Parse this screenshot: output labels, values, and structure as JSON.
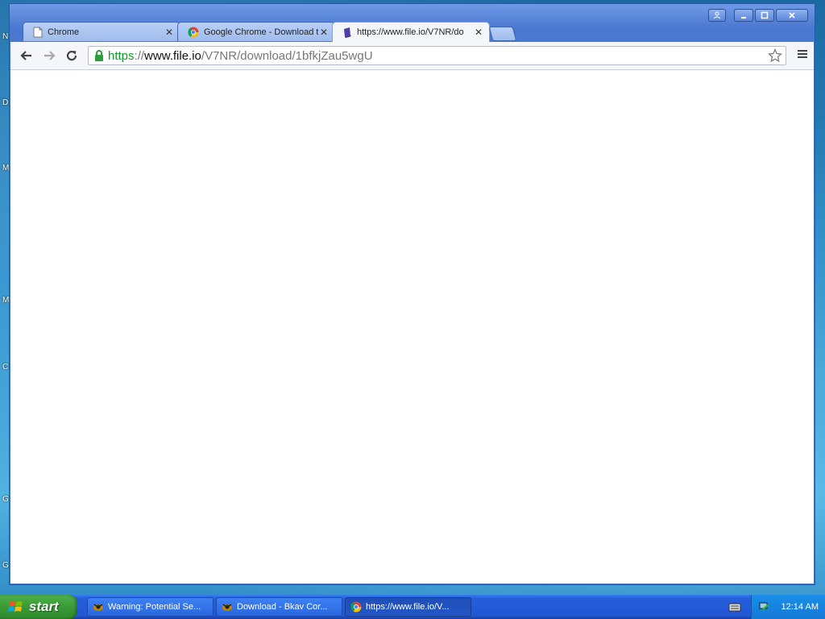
{
  "desktop": {
    "letters": [
      "N",
      "D",
      "M",
      "M",
      "C",
      "G",
      "G"
    ]
  },
  "window": {
    "controls": {
      "profile_icon": "person-icon",
      "minimize_icon": "minimize-icon",
      "maximize_icon": "maximize-icon",
      "close_icon": "close-icon"
    }
  },
  "tabs": [
    {
      "title": "Chrome",
      "icon": "page-icon",
      "active": false
    },
    {
      "title": "Google Chrome - Download t",
      "icon": "chrome-icon",
      "active": false
    },
    {
      "title": "https://www.file.io/V7NR/do",
      "icon": "file-io-icon",
      "active": true
    }
  ],
  "toolbar": {
    "url_scheme": "https",
    "url_sep": "://",
    "url_host": "www.file.io",
    "url_path": "/V7NR/download/1bfkjZau5wgU"
  },
  "taskbar": {
    "start_label": "start",
    "tasks": [
      {
        "label": "Warning: Potential Se...",
        "icon": "bkav-icon",
        "active": false
      },
      {
        "label": "Download - Bkav Cor...",
        "icon": "bkav-icon",
        "active": false
      },
      {
        "label": "https://www.file.io/V...",
        "icon": "chrome-icon",
        "active": true
      }
    ],
    "clock": "12:14 AM"
  },
  "colors": {
    "accent": "#4a78d0",
    "https_green": "#119a29"
  }
}
